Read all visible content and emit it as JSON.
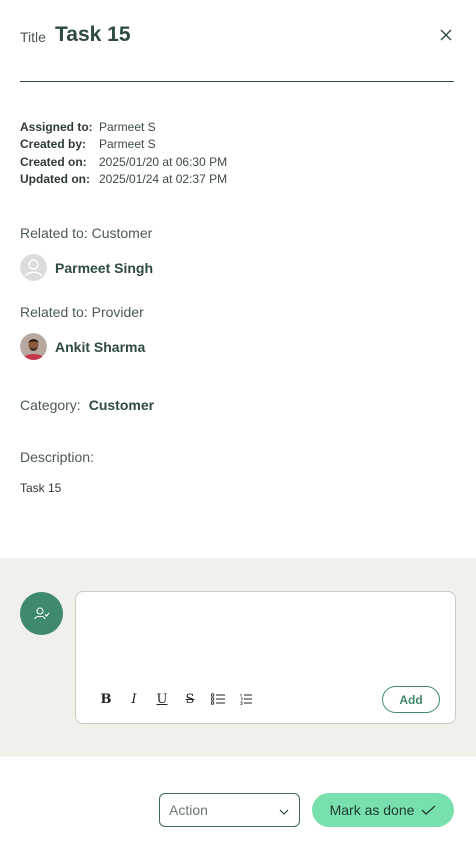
{
  "header": {
    "title_label": "Title",
    "title_value": "Task 15"
  },
  "meta": [
    {
      "key": "Assigned to:",
      "value": "Parmeet S"
    },
    {
      "key": "Created by:",
      "value": "Parmeet S"
    },
    {
      "key": "Created on:",
      "value": "2025/01/20 at 06:30 PM"
    },
    {
      "key": "Updated on:",
      "value": "2025/01/24 at 02:37 PM"
    }
  ],
  "related_customer": {
    "label": "Related to: Customer",
    "name": "Parmeet Singh"
  },
  "related_provider": {
    "label": "Related to: Provider",
    "name": "Ankit Sharma"
  },
  "category": {
    "label": "Category:",
    "value": "Customer"
  },
  "description": {
    "label": "Description:",
    "text": "Task 15"
  },
  "comment": {
    "add_label": "Add",
    "tools": [
      "bold-icon",
      "italic-icon",
      "underline-icon",
      "strikethrough-icon",
      "bullet-list-icon",
      "numbered-list-icon"
    ]
  },
  "footer": {
    "action_label": "Action",
    "done_label": "Mark as done"
  },
  "colors": {
    "accent": "#3e8a6a",
    "done_button": "#78e0ad",
    "comment_bg": "#f0f1eb"
  }
}
